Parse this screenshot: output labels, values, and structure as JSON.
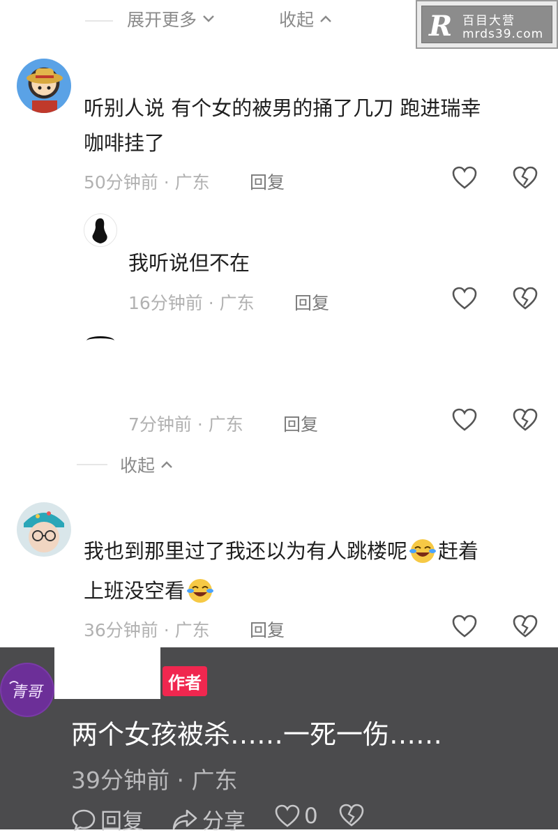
{
  "top_controls": {
    "expand_label": "展开更多",
    "collapse_label": "收起"
  },
  "watermark": {
    "logo": "R",
    "line1": "百目大营",
    "line2": "mrds39.com"
  },
  "comments": [
    {
      "text_line1": "听别人说  有个女的被男的捅了几刀 跑进瑞幸",
      "text_line2": "咖啡挂了",
      "meta": "50分钟前 · 广东",
      "reply_label": "回复"
    },
    {
      "text_line1": "我听说但不在",
      "meta": "16分钟前 · 广东",
      "reply_label": "回复"
    },
    {
      "meta": "7分钟前 · 广东",
      "reply_label": "回复"
    },
    {
      "text_line1": "我也到那里过了我还以为有人跳楼呢",
      "text_line1_tail": "赶着",
      "text_line2": "上班没空看",
      "meta": "36分钟前 · 广东",
      "reply_label": "回复"
    }
  ],
  "mid_collapse_label": "收起",
  "author_comment": {
    "badge": "作者",
    "text": "两个女孩被杀……一死一伤……",
    "meta": "39分钟前 · 广东",
    "reply_label": "回复",
    "share_label": "分享",
    "like_count": "0",
    "avatar_text": "青哥"
  },
  "colors": {
    "badge": "#f0274f",
    "dark_bg": "#4b4b4d"
  },
  "icons": [
    "chevron-down-icon",
    "chevron-up-icon",
    "heart-icon",
    "broken-heart-icon",
    "comment-bubble-icon",
    "share-arrow-icon",
    "laugh-cry-emoji-icon"
  ]
}
